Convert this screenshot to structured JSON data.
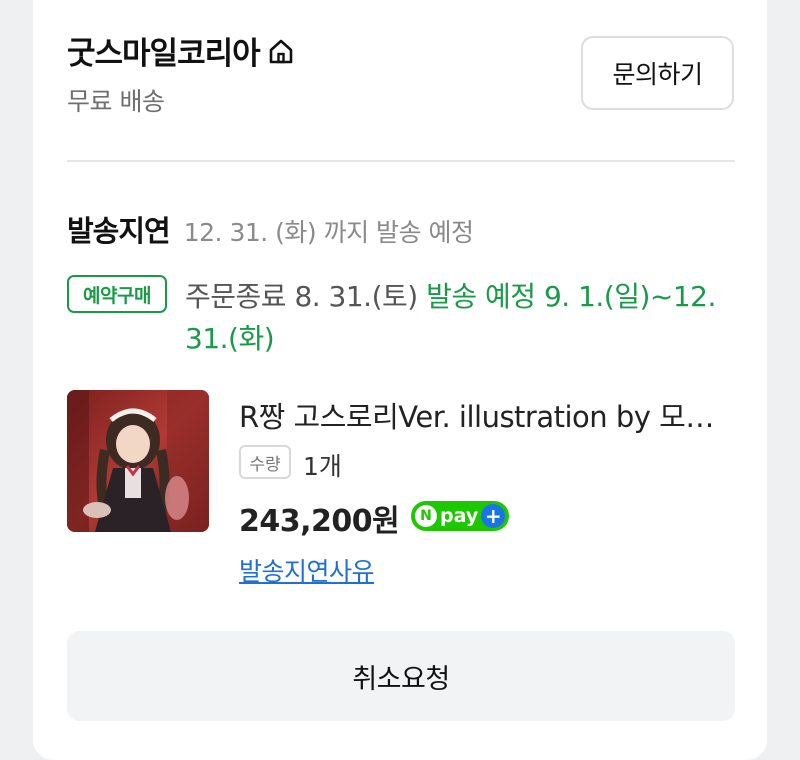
{
  "seller": {
    "name": "굿스마일코리아",
    "shipping_fee": "무료 배송",
    "inquiry_label": "문의하기"
  },
  "delivery_status": {
    "title": "발송지연",
    "date": "12. 31. (화) 까지 발송 예정"
  },
  "preorder": {
    "badge": "예약구매",
    "order_end": "주문종료 8. 31.(토)",
    "ship_plan": "발송 예정 9. 1.(일)~12. 31.(화)"
  },
  "product": {
    "title": "R짱 고스로리Ver. illustration by 모…",
    "qty_label": "수량",
    "qty_value": "1개",
    "price": "243,200원",
    "npay_text": "pay",
    "delay_reason_link": "발송지연사유"
  },
  "actions": {
    "cancel_label": "취소요청"
  },
  "colors": {
    "accent_green": "#1a9a48",
    "link_blue": "#1f6fd6",
    "npay_green": "#1ec800"
  }
}
